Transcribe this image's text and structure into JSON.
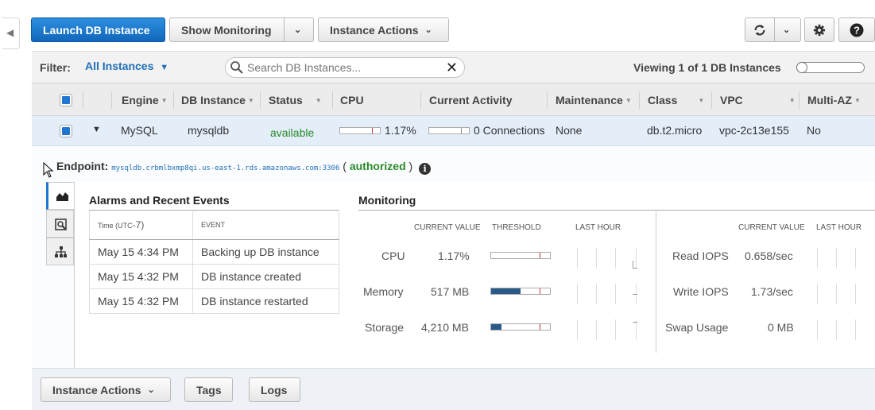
{
  "toolbar": {
    "launch": "Launch DB Instance",
    "monitoring": "Show Monitoring",
    "instance_actions": "Instance Actions"
  },
  "filter": {
    "label": "Filter:",
    "selected": "All Instances",
    "search_placeholder": "Search DB Instances...",
    "viewing": "Viewing 1 of 1 DB Instances"
  },
  "columns": [
    "Engine",
    "DB Instance",
    "Status",
    "CPU",
    "Current Activity",
    "Maintenance",
    "Class",
    "VPC",
    "Multi-AZ"
  ],
  "row": {
    "engine": "MySQL",
    "instance": "mysqldb",
    "status": "available",
    "cpu": "1.17%",
    "cpu_fraction": 0.0117,
    "activity": "0 Connections",
    "maintenance": "None",
    "class": "db.t2.micro",
    "vpc": "vpc-2c13e155",
    "multi_az": "No"
  },
  "details": {
    "endpoint_label": "Endpoint:",
    "endpoint_url": "mysqldb.crbmlbxmp8qi.us-east-1.rds.amazonaws.com:3306",
    "auth_open": "(",
    "auth": "authorized",
    "auth_close": ")"
  },
  "alarms": {
    "title": "Alarms and Recent Events",
    "col_time_1": "Time (",
    "col_time_2": "UTC",
    "col_time_3": "-7)",
    "col_event": "EVENT",
    "events": [
      {
        "time": "May 15 4:34 PM",
        "event": "Backing up DB instance"
      },
      {
        "time": "May 15 4:32 PM",
        "event": "DB instance created"
      },
      {
        "time": "May 15 4:32 PM",
        "event": "DB instance restarted"
      }
    ]
  },
  "monitoring": {
    "title": "Monitoring",
    "hdr_current": "CURRENT VALUE",
    "hdr_threshold": "THRESHOLD",
    "hdr_last_hour": "LAST HOUR",
    "left": [
      {
        "label": "CPU",
        "value": "1.17%",
        "fill": 0.0
      },
      {
        "label": "Memory",
        "value": "517 MB",
        "fill": 0.5
      },
      {
        "label": "Storage",
        "value": "4,210 MB",
        "fill": 0.17
      }
    ],
    "right": [
      {
        "label": "Read IOPS",
        "value": "0.658/sec"
      },
      {
        "label": "Write IOPS",
        "value": "1.73/sec"
      },
      {
        "label": "Swap Usage",
        "value": "0 MB"
      }
    ]
  },
  "bottom": {
    "instance_actions": "Instance Actions",
    "tags": "Tags",
    "logs": "Logs"
  },
  "colors": {
    "primary": "#1a73c6",
    "available": "#2a8a2a",
    "link": "#1f6fb8"
  }
}
